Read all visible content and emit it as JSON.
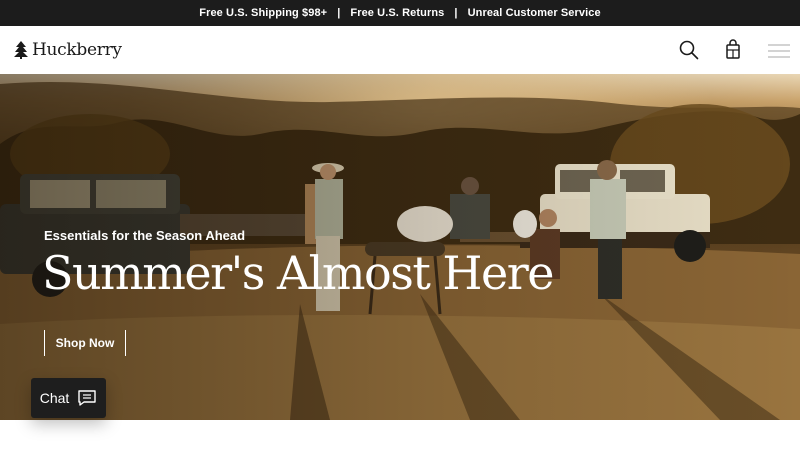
{
  "announcement": {
    "items": [
      "Free U.S. Shipping $98+",
      "Free U.S. Returns",
      "Unreal Customer Service"
    ],
    "separator": "|"
  },
  "header": {
    "brand": "Huckberry",
    "icons": [
      "tree-logo-icon",
      "search-icon",
      "shopping-bag-icon",
      "menu-icon"
    ]
  },
  "hero": {
    "eyebrow": "Essentials for the Season Ahead",
    "headline": "Summer's Almost Here",
    "cta_label": "Shop Now"
  },
  "chat": {
    "label": "Chat",
    "icon": "chat-bubble-icon"
  },
  "colors": {
    "announcement_bg": "#1c1c1c",
    "header_bg": "#ffffff",
    "text_on_hero": "#ffffff",
    "chat_bg": "#1e1e1e"
  }
}
